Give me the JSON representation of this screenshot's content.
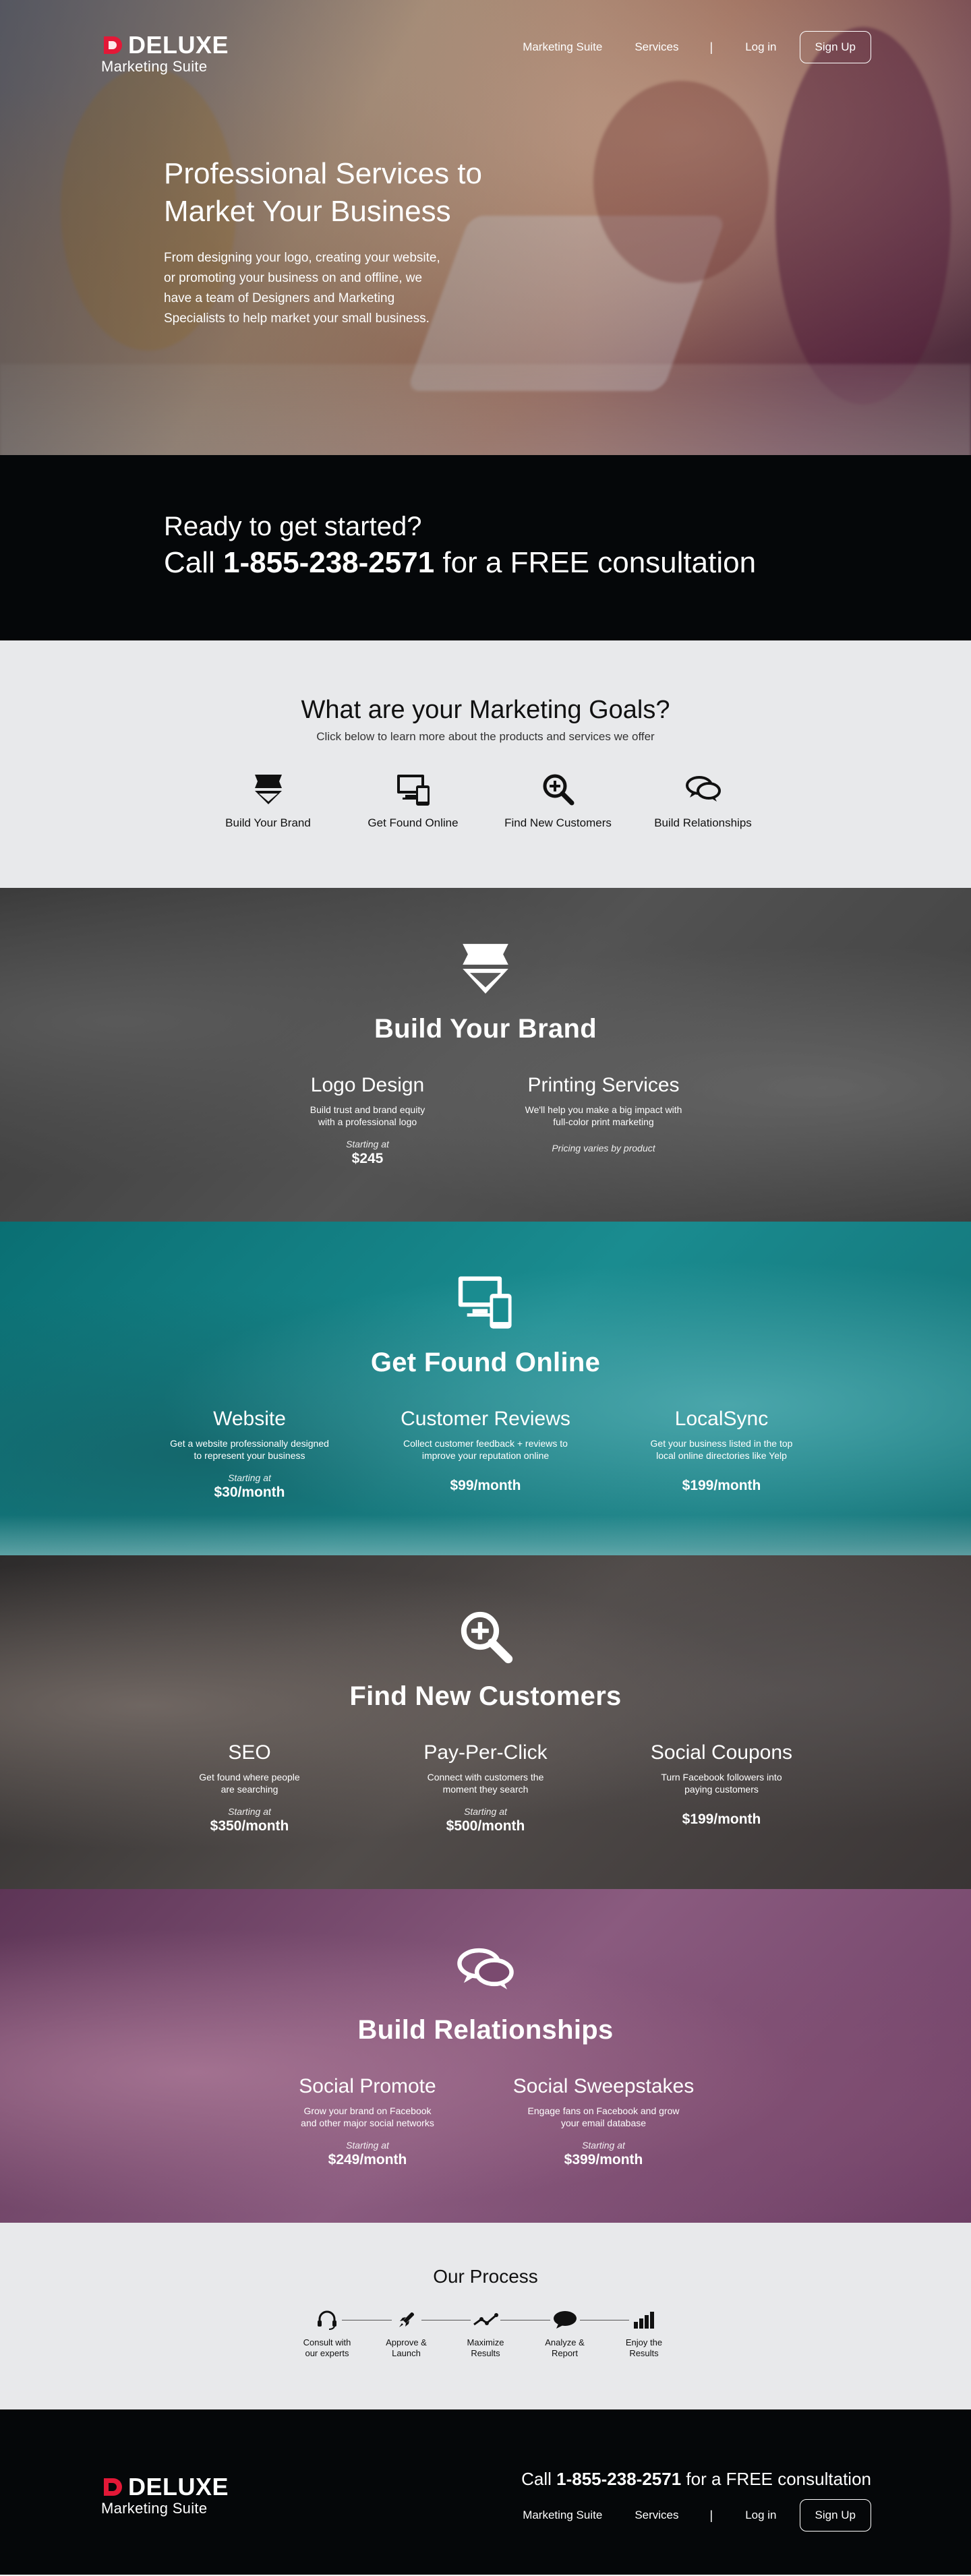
{
  "brand": {
    "name": "DELUXE",
    "subtitle": "Marketing Suite",
    "accent_color": "#e31837"
  },
  "nav": {
    "marketing_suite": "Marketing Suite",
    "services": "Services",
    "separator": "|",
    "login": "Log in",
    "signup": "Sign Up"
  },
  "hero": {
    "title_line1": "Professional Services to",
    "title_line2": "Market Your Business",
    "description": "From designing your logo, creating your website, or promoting your business on and offline, we have a team of Designers and Marketing Specialists to help market your small business."
  },
  "cta": {
    "line1": "Ready to get started?",
    "line2_prefix": "Call ",
    "phone": "1-855-238-2571",
    "line2_suffix": " for a FREE consultation"
  },
  "goals": {
    "title": "What are your Marketing Goals?",
    "subtitle": "Click below to learn more about the products and services we offer",
    "items": [
      {
        "label": "Build Your Brand",
        "icon": "brand-badge-icon"
      },
      {
        "label": "Get Found Online",
        "icon": "devices-icon"
      },
      {
        "label": "Find New Customers",
        "icon": "magnifier-plus-icon"
      },
      {
        "label": "Build Relationships",
        "icon": "chat-bubbles-icon"
      }
    ]
  },
  "sections": {
    "brand": {
      "title": "Build Your Brand",
      "products": [
        {
          "name": "Logo Design",
          "desc_line1": "Build trust and brand equity",
          "desc_line2": "with a professional logo",
          "starting": "Starting at",
          "price": "$245"
        },
        {
          "name": "Printing Services",
          "desc_line1": "We'll help you make a big impact with",
          "desc_line2": "full-color print marketing",
          "note": "Pricing varies by product"
        }
      ]
    },
    "online": {
      "title": "Get Found Online",
      "products": [
        {
          "name": "Website",
          "desc_line1": "Get a website professionally designed",
          "desc_line2": "to represent your business",
          "starting": "Starting at",
          "price": "$30/month"
        },
        {
          "name": "Customer Reviews",
          "desc_line1": "Collect customer feedback + reviews to",
          "desc_line2": "improve your reputation online",
          "price": "$99/month"
        },
        {
          "name": "LocalSync",
          "desc_line1": "Get your business listed in the top",
          "desc_line2": "local online directories like Yelp",
          "price": "$199/month"
        }
      ]
    },
    "customers": {
      "title": "Find New Customers",
      "products": [
        {
          "name": "SEO",
          "desc_line1": "Get found where people",
          "desc_line2": "are searching",
          "starting": "Starting at",
          "price": "$350/month"
        },
        {
          "name": "Pay-Per-Click",
          "desc_line1": "Connect with customers the",
          "desc_line2": "moment they search",
          "starting": "Starting at",
          "price": "$500/month"
        },
        {
          "name": "Social Coupons",
          "desc_line1": "Turn Facebook followers into",
          "desc_line2": "paying customers",
          "price": "$199/month"
        }
      ]
    },
    "relations": {
      "title": "Build Relationships",
      "products": [
        {
          "name": "Social Promote",
          "desc_line1": "Grow your brand on Facebook",
          "desc_line2": "and other major social networks",
          "starting": "Starting at",
          "price": "$249/month"
        },
        {
          "name": "Social Sweepstakes",
          "desc_line1": "Engage fans on  Facebook and grow",
          "desc_line2": "your email database",
          "starting": "Starting at",
          "price": "$399/month"
        }
      ]
    }
  },
  "process": {
    "title": "Our Process",
    "steps": [
      {
        "line1": "Consult with",
        "line2": "our experts",
        "icon": "headset-icon"
      },
      {
        "line1": "Approve &",
        "line2": "Launch",
        "icon": "rocket-icon"
      },
      {
        "line1": "Maximize",
        "line2": "Results",
        "icon": "trend-line-icon"
      },
      {
        "line1": "Analyze &",
        "line2": "Report",
        "icon": "speech-bubble-icon"
      },
      {
        "line1": "Enjoy the",
        "line2": "Results",
        "icon": "bar-chart-icon"
      }
    ]
  },
  "footer": {
    "cta_prefix": "Call ",
    "phone": "1-855-238-2571",
    "cta_suffix": " for a FREE consultation"
  }
}
